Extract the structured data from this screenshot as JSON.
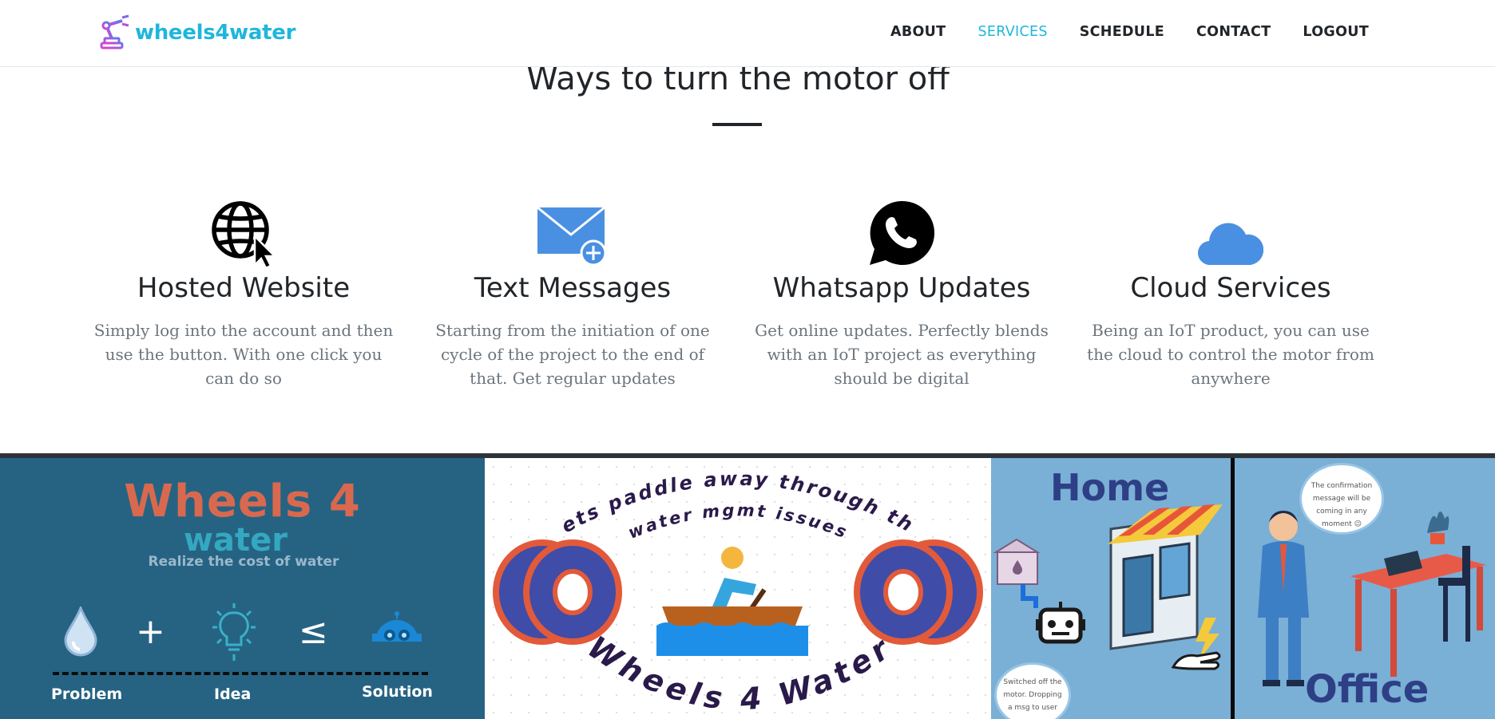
{
  "brand": {
    "name": "wheels4water",
    "logo_icon": "robot-arm-icon"
  },
  "nav": {
    "items": [
      {
        "label": "ABOUT",
        "active": false
      },
      {
        "label": "SERVICES",
        "active": true
      },
      {
        "label": "SCHEDULE",
        "active": false
      },
      {
        "label": "CONTACT",
        "active": false
      },
      {
        "label": "LOGOUT",
        "active": false
      }
    ]
  },
  "section": {
    "title": "Ways to turn the motor off"
  },
  "services": [
    {
      "icon": "globe-cursor-icon",
      "title": "Hosted Website",
      "text": "Simply log into the account and then use the button. With one click you can do so"
    },
    {
      "icon": "envelope-plus-icon",
      "title": "Text Messages",
      "text": "Starting from the initiation of one cycle of the project to the end of that. Get regular updates"
    },
    {
      "icon": "whatsapp-icon",
      "title": "Whatsapp Updates",
      "text": "Get online updates. Perfectly blends with an IoT project as everything should be digital"
    },
    {
      "icon": "cloud-icon",
      "title": "Cloud Services",
      "text": "Being an IoT product, you can use the cloud to control the motor from anywhere"
    }
  ],
  "banners": {
    "panel1": {
      "title": "Wheels 4",
      "subtitle": "water",
      "tagline": "Realize the cost of water",
      "labels": [
        "Problem",
        "Idea",
        "Solution"
      ],
      "symbols": [
        "+",
        "≤"
      ]
    },
    "panel2": {
      "arc_top": "Lets paddle away through the",
      "arc_mid": "water mgmt issues",
      "arc_bottom": "Wheels 4 Water"
    },
    "panel3": {
      "home_label": "Home",
      "office_label": "Office",
      "bubble_office": "The confirmation message will be coming in any moment 😉",
      "bubble_home": "Switched off the motor. Dropping a msg to user"
    }
  },
  "colors": {
    "accent": "#1fb6dc",
    "text_dark": "#212529",
    "text_muted": "#6c757d",
    "icon_blue": "#4a90e2",
    "panel1_bg": "#266383",
    "panel3_bg": "#7aafd6"
  }
}
